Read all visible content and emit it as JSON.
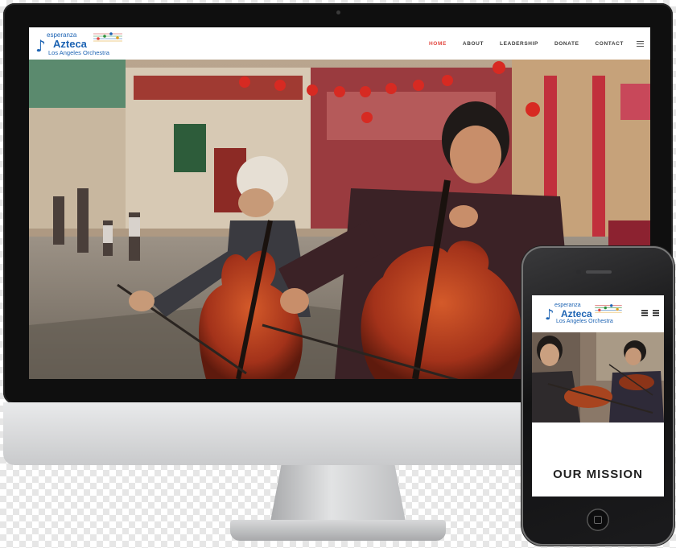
{
  "desktop_site": {
    "logo": {
      "line1": "esperanza",
      "line2": "Azteca",
      "line3": "Los Angeles Orchestra"
    },
    "nav": {
      "items": [
        {
          "label": "HOME",
          "active": true
        },
        {
          "label": "ABOUT",
          "active": false
        },
        {
          "label": "LEADERSHIP",
          "active": false
        },
        {
          "label": "DONATE",
          "active": false
        },
        {
          "label": "CONTACT",
          "active": false
        }
      ],
      "menu_icon": "hamburger-icon"
    },
    "hero_image": "two children playing cellos on a Chinatown street"
  },
  "mobile_site": {
    "logo": {
      "line1": "esperanza",
      "line2": "Azteca",
      "line3": "Los Angeles Orchestra"
    },
    "icons": [
      "list-icon",
      "hamburger-icon"
    ],
    "hero_image": "children playing violins",
    "mission_heading": "OUR MISSION"
  },
  "colors": {
    "accent_active_nav": "#e2473f",
    "logo_blue": "#1c63b3"
  }
}
